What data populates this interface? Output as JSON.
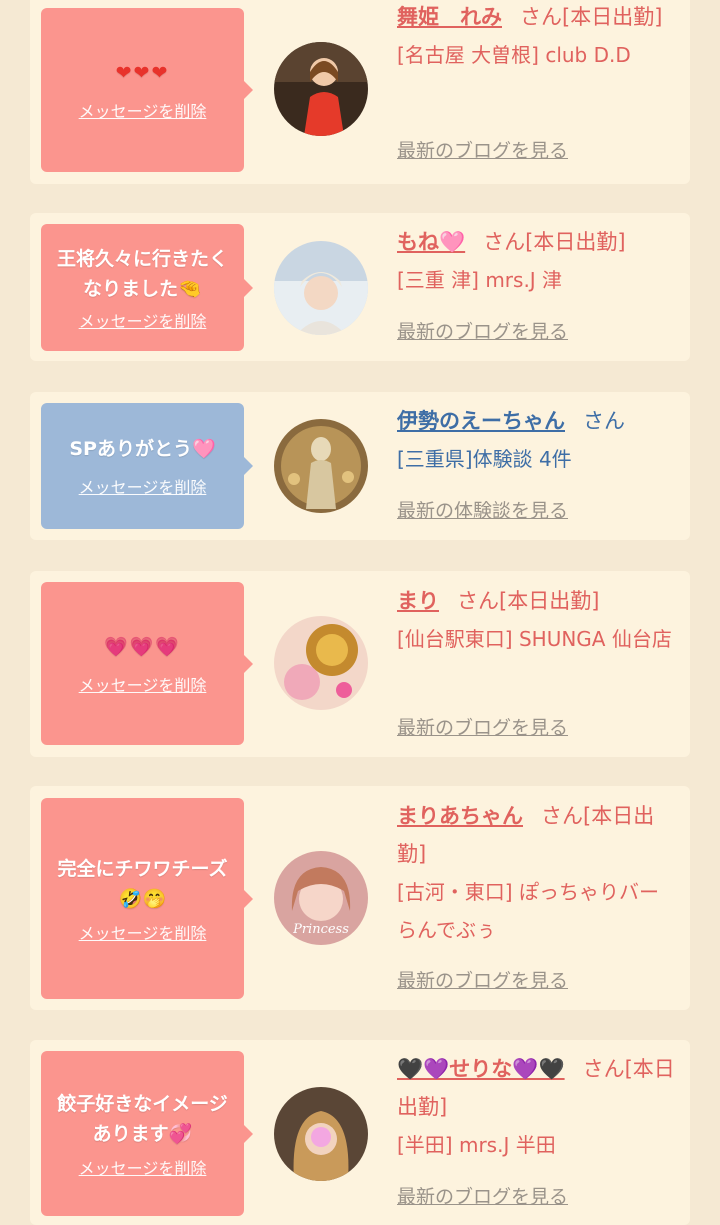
{
  "cards": [
    {
      "message": "❤❤❤",
      "delete_label": "メッセージを削除",
      "name": "舞姫　れみ",
      "suffix": "さん[本日出勤]",
      "shop": "[名古屋 大曽根] club D.D",
      "link": "最新のブログを見る",
      "theme": "pink"
    },
    {
      "message": "王将久々に行きたくなりました🤏",
      "delete_label": "メッセージを削除",
      "name": "もね🩷",
      "suffix": "さん[本日出勤]",
      "shop": "[三重 津] mrs.J 津",
      "link": "最新のブログを見る",
      "theme": "pink"
    },
    {
      "message": "SPありがとう🩷",
      "delete_label": "メッセージを削除",
      "name": "伊勢のえーちゃん",
      "suffix": "さん",
      "shop": "[三重県]体験談 4件",
      "link": "最新の体験談を見る",
      "theme": "blue"
    },
    {
      "message": "💗💗💗",
      "delete_label": "メッセージを削除",
      "name": "まり",
      "suffix": "さん[本日出勤]",
      "shop": "[仙台駅東口] SHUNGA 仙台店",
      "link": "最新のブログを見る",
      "theme": "pink"
    },
    {
      "message": "完全にチワワチーズ🤣🤭",
      "delete_label": "メッセージを削除",
      "name": "まりあちゃん",
      "suffix": "さん[本日出勤]",
      "shop": "[古河・東口] ぽっちゃりバー らんでぶぅ",
      "link": "最新のブログを見る",
      "theme": "pink"
    },
    {
      "message": "餃子好きなイメージあります💞",
      "delete_label": "メッセージを削除",
      "name": "🖤💜せりな💜🖤",
      "suffix": "さん[本日出勤]",
      "shop": "[半田] mrs.J 半田",
      "link": "最新のブログを見る",
      "theme": "pink"
    }
  ]
}
